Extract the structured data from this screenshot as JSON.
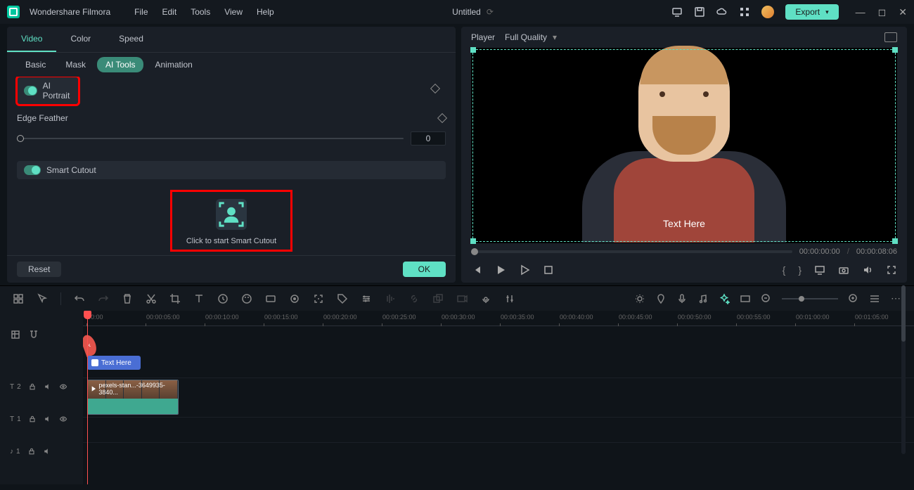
{
  "app": {
    "name": "Wondershare Filmora",
    "docTitle": "Untitled"
  },
  "menu": [
    "File",
    "Edit",
    "Tools",
    "View",
    "Help"
  ],
  "export": {
    "label": "Export"
  },
  "leftPanel": {
    "topTabs": [
      "Video",
      "Color",
      "Speed"
    ],
    "activeTopTab": "Video",
    "subTabs": [
      "Basic",
      "Mask",
      "AI Tools",
      "Animation"
    ],
    "activeSubTab": "AI Tools",
    "aiPortrait": {
      "label": "AI Portrait"
    },
    "edgeFeather": {
      "label": "Edge Feather",
      "value": "0"
    },
    "smartCutout": {
      "label": "Smart Cutout",
      "cta": "Click to start Smart Cutout"
    },
    "reset": "Reset",
    "ok": "OK"
  },
  "player": {
    "label": "Player",
    "quality": "Full Quality",
    "textOverlay": "Text Here",
    "current": "00:00:00:00",
    "duration": "00:00:08:06"
  },
  "timeline": {
    "ticks": [
      "00:00",
      "00:00:05:00",
      "00:00:10:00",
      "00:00:15:00",
      "00:00:20:00",
      "00:00:25:00",
      "00:00:30:00",
      "00:00:35:00",
      "00:00:40:00",
      "00:00:45:00",
      "00:00:50:00",
      "00:00:55:00",
      "00:01:00:00",
      "00:01:05:00"
    ],
    "tracks": {
      "t2": {
        "icon": "T",
        "num": "2"
      },
      "t1": {
        "icon": "T",
        "num": "1"
      },
      "a1": {
        "icon": "♪",
        "num": "1"
      }
    },
    "textClip": "Text Here",
    "videoClip": "pexels-stan...-3649935-3840..."
  }
}
